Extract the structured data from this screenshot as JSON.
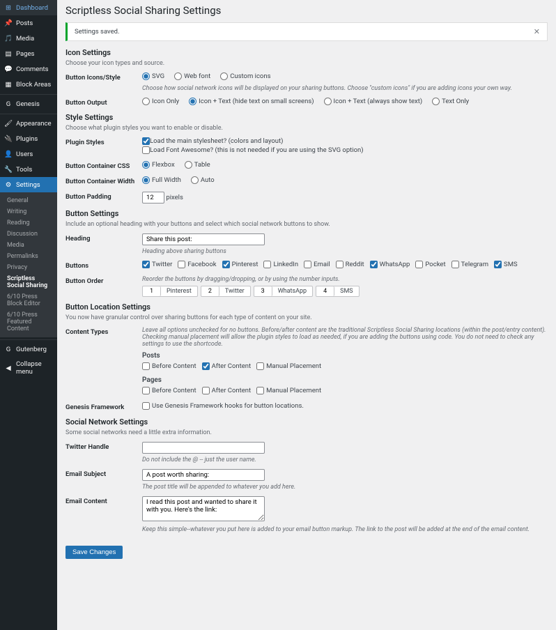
{
  "sidebar": {
    "items": [
      {
        "label": "Dashboard",
        "icon": "dashboard-icon"
      },
      {
        "label": "Posts",
        "icon": "pin-icon"
      },
      {
        "label": "Media",
        "icon": "media-icon"
      },
      {
        "label": "Pages",
        "icon": "page-icon"
      },
      {
        "label": "Comments",
        "icon": "comment-icon"
      },
      {
        "label": "Block Areas",
        "icon": "block-icon"
      },
      {
        "label": "Genesis",
        "icon": "genesis-icon"
      },
      {
        "label": "Appearance",
        "icon": "brush-icon"
      },
      {
        "label": "Plugins",
        "icon": "plug-icon"
      },
      {
        "label": "Users",
        "icon": "user-icon"
      },
      {
        "label": "Tools",
        "icon": "wrench-icon"
      },
      {
        "label": "Settings",
        "icon": "gear-icon"
      }
    ],
    "settings_sub": [
      "General",
      "Writing",
      "Reading",
      "Discussion",
      "Media",
      "Permalinks",
      "Privacy",
      "Scriptless Social Sharing",
      "6/10 Press Block Editor",
      "6/10 Press Featured Content"
    ],
    "tail": [
      {
        "label": "Gutenberg",
        "icon": "gutenberg-icon"
      },
      {
        "label": "Collapse menu",
        "icon": "collapse-icon"
      }
    ]
  },
  "page": {
    "title": "Scriptless Social Sharing Settings",
    "notice": "Settings saved.",
    "save_button": "Save Changes"
  },
  "icon_settings": {
    "heading": "Icon Settings",
    "desc": "Choose your icon types and source.",
    "style_label": "Button Icons/Style",
    "style_options": [
      "SVG",
      "Web font",
      "Custom icons"
    ],
    "style_value": "SVG",
    "style_hint": "Choose how social network icons will be displayed on your sharing buttons. Choose \"custom icons\" if you are adding icons your own way.",
    "output_label": "Button Output",
    "output_options": [
      "Icon Only",
      "Icon + Text (hide text on small screens)",
      "Icon + Text (always show text)",
      "Text Only"
    ],
    "output_value": "Icon + Text (hide text on small screens)"
  },
  "style_settings": {
    "heading": "Style Settings",
    "desc": "Choose what plugin styles you want to enable or disable.",
    "plugin_styles_label": "Plugin Styles",
    "plugin_styles_options": [
      {
        "label": "Load the main stylesheet? (colors and layout)",
        "checked": true
      },
      {
        "label": "Load Font Awesome? (this is not needed if you are using the SVG option)",
        "checked": false
      }
    ],
    "container_css_label": "Button Container CSS",
    "container_css_options": [
      "Flexbox",
      "Table"
    ],
    "container_css_value": "Flexbox",
    "container_width_label": "Button Container Width",
    "container_width_options": [
      "Full Width",
      "Auto"
    ],
    "container_width_value": "Full Width",
    "padding_label": "Button Padding",
    "padding_value": "12",
    "padding_unit": "pixels"
  },
  "button_settings": {
    "heading": "Button Settings",
    "desc": "Include an optional heading with your buttons and select which social network buttons to show.",
    "heading_label": "Heading",
    "heading_value": "Share this post:",
    "heading_hint": "Heading above sharing buttons",
    "buttons_label": "Buttons",
    "buttons": [
      {
        "label": "Twitter",
        "checked": true
      },
      {
        "label": "Facebook",
        "checked": false
      },
      {
        "label": "Pinterest",
        "checked": true
      },
      {
        "label": "LinkedIn",
        "checked": false
      },
      {
        "label": "Email",
        "checked": false
      },
      {
        "label": "Reddit",
        "checked": false
      },
      {
        "label": "WhatsApp",
        "checked": true
      },
      {
        "label": "Pocket",
        "checked": false
      },
      {
        "label": "Telegram",
        "checked": false
      },
      {
        "label": "SMS",
        "checked": true
      }
    ],
    "order_label": "Button Order",
    "order_hint": "Reorder the buttons by dragging/dropping, or by using the number inputs.",
    "order": [
      {
        "n": "1",
        "label": "Pinterest"
      },
      {
        "n": "2",
        "label": "Twitter"
      },
      {
        "n": "3",
        "label": "WhatsApp"
      },
      {
        "n": "4",
        "label": "SMS"
      }
    ]
  },
  "location_settings": {
    "heading": "Button Location Settings",
    "desc": "You now have granular control over sharing buttons for each type of content on your site.",
    "content_types_label": "Content Types",
    "content_types_hint": "Leave all options unchecked for no buttons. Before/after content are the traditional Scriptless Social Sharing locations (within the post/entry content). Checking manual placement will allow the plugin styles to load as needed, if you are adding the buttons using code. You do not need to check any settings to use the shortcode.",
    "posts_label": "Posts",
    "posts_options": [
      {
        "label": "Before Content",
        "checked": false
      },
      {
        "label": "After Content",
        "checked": true
      },
      {
        "label": "Manual Placement",
        "checked": false
      }
    ],
    "pages_label": "Pages",
    "pages_options": [
      {
        "label": "Before Content",
        "checked": false
      },
      {
        "label": "After Content",
        "checked": false
      },
      {
        "label": "Manual Placement",
        "checked": false
      }
    ],
    "genesis_label": "Genesis Framework",
    "genesis_option": {
      "label": "Use Genesis Framework hooks for button locations.",
      "checked": false
    }
  },
  "social_settings": {
    "heading": "Social Network Settings",
    "desc": "Some social networks need a little extra information.",
    "twitter_label": "Twitter Handle",
    "twitter_value": "",
    "twitter_hint": "Do not include the @ -- just the user name.",
    "email_subject_label": "Email Subject",
    "email_subject_value": "A post worth sharing:",
    "email_subject_hint": "The post title will be appended to whatever you add here.",
    "email_content_label": "Email Content",
    "email_content_value": "I read this post and wanted to share it with you. Here's the link:",
    "email_content_hint": "Keep this simple--whatever you put here is added to your email button markup. The link to the post will be added at the end of the email content."
  }
}
